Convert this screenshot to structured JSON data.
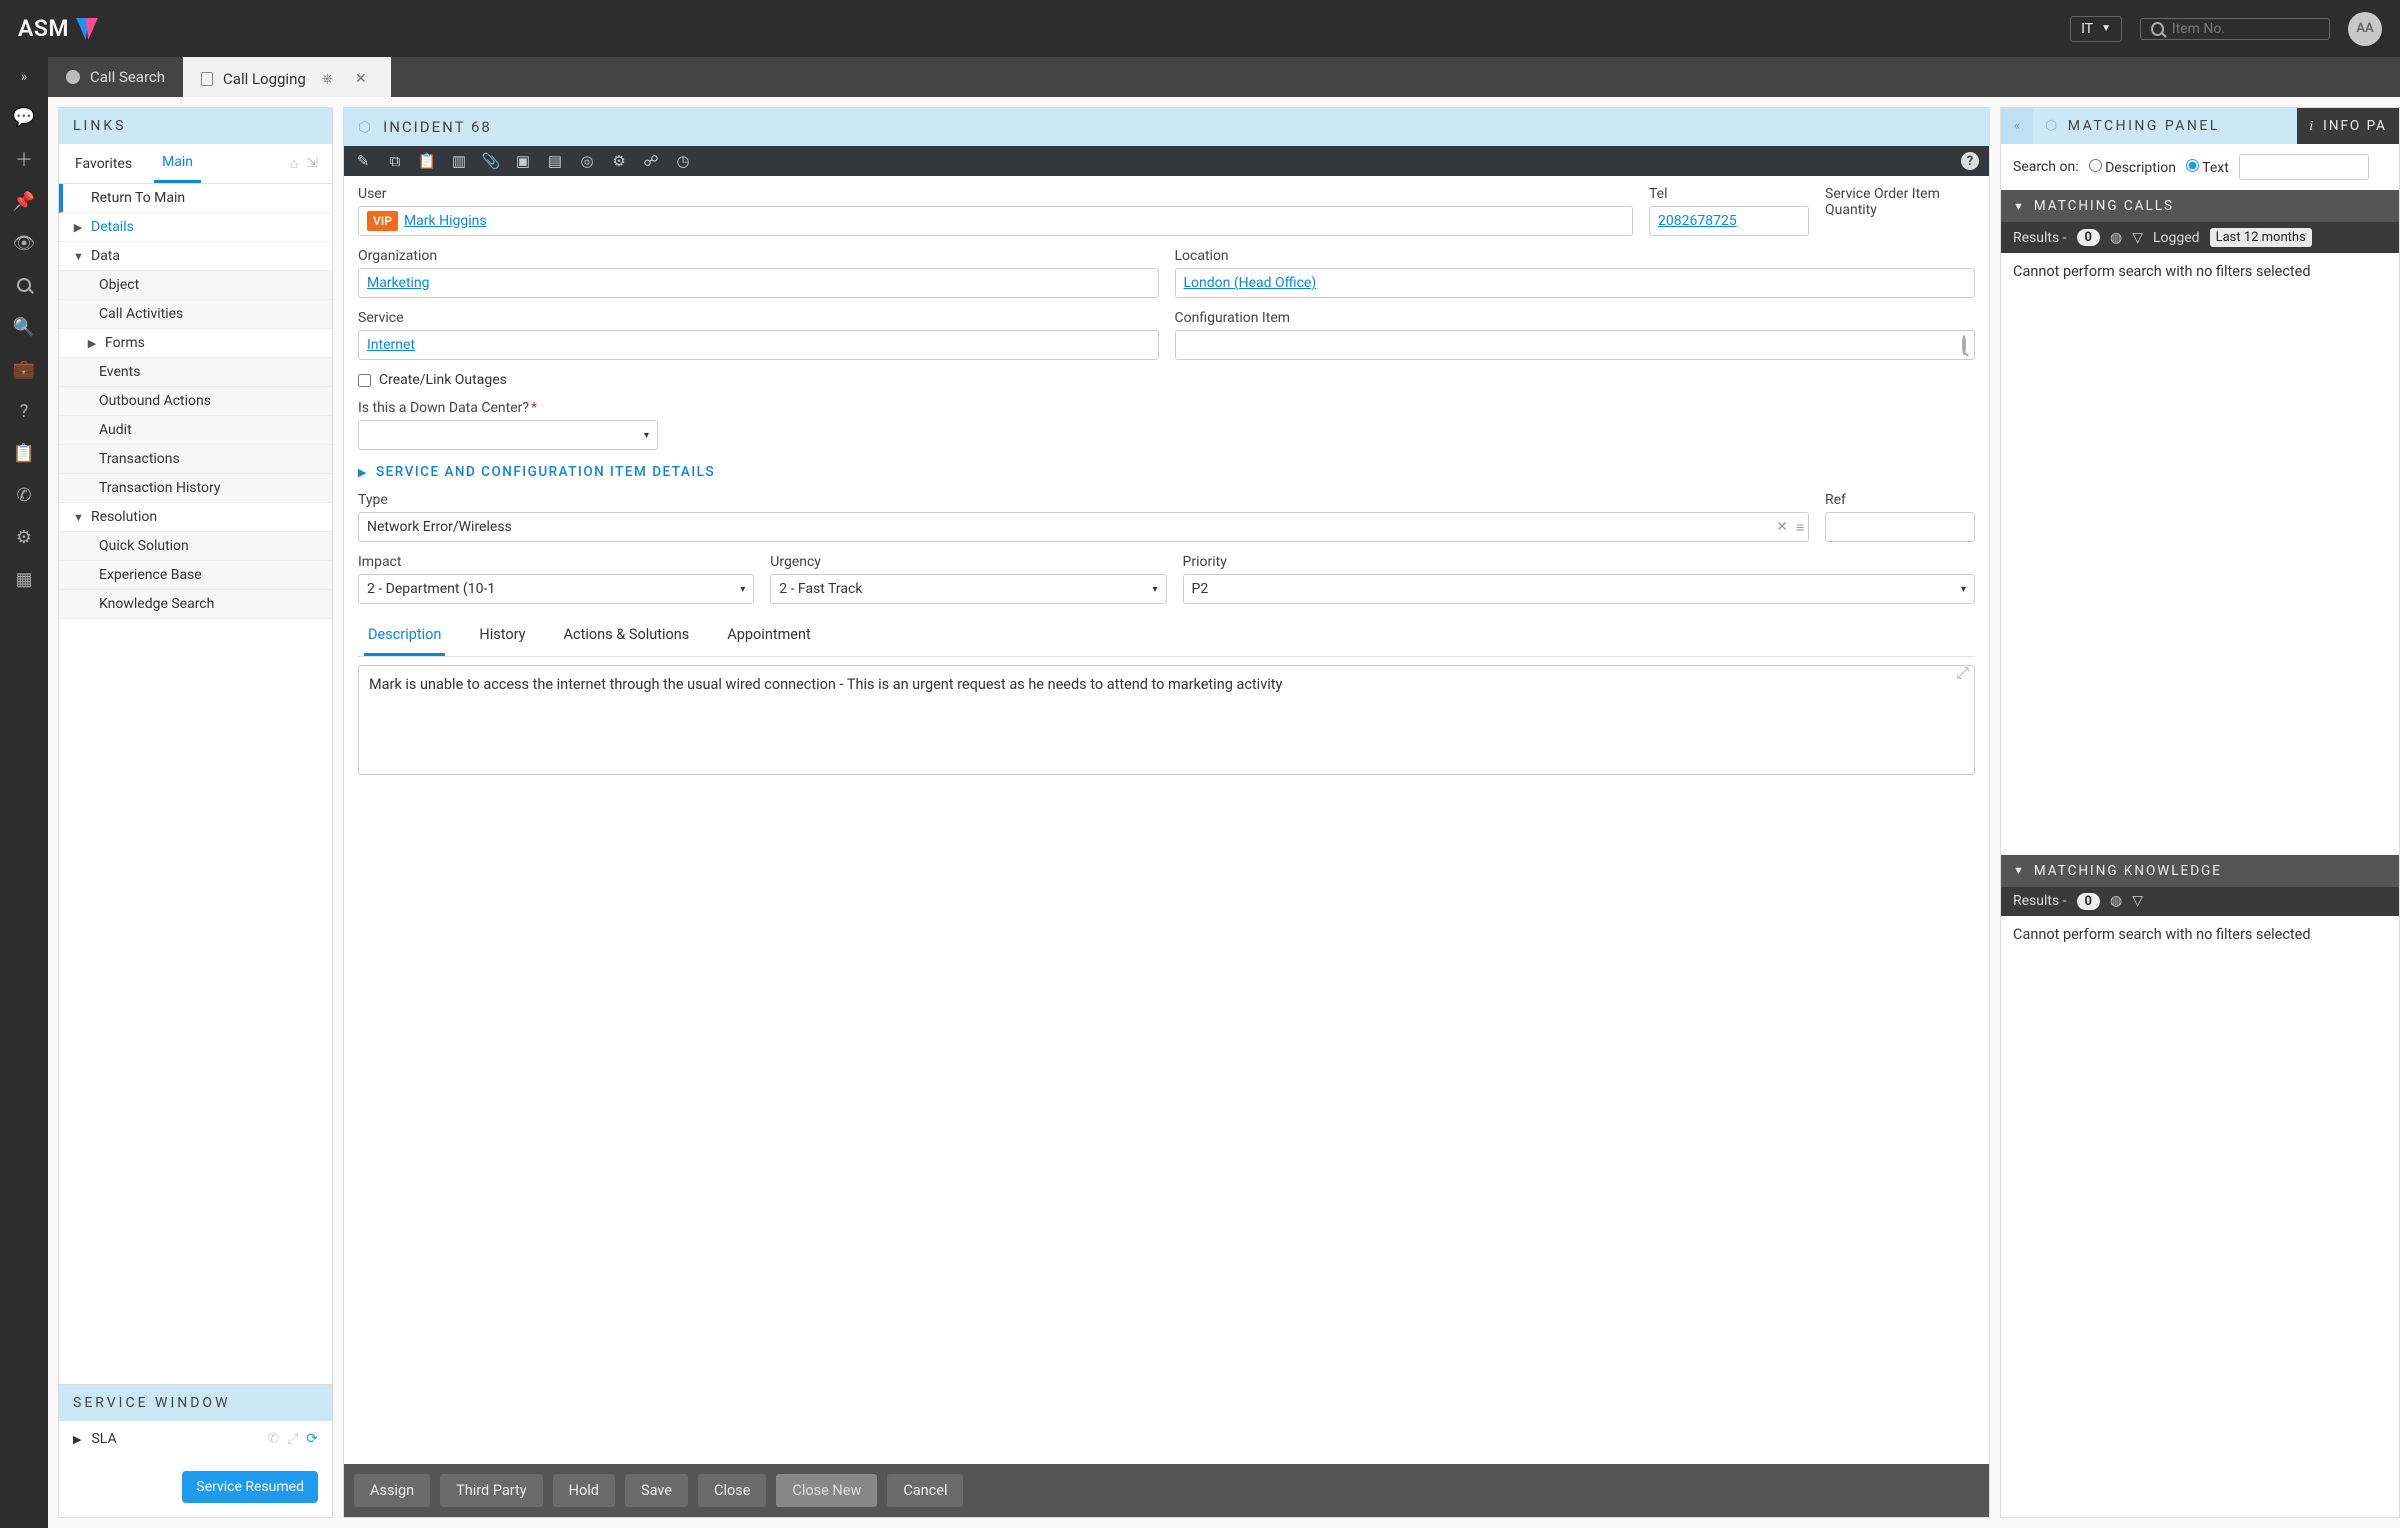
{
  "topbar": {
    "logo_text": "ASM",
    "dept_selector": "IT",
    "item_search_placeholder": "Item No.",
    "avatar_initials": "AA"
  },
  "tabs": {
    "call_search": "Call Search",
    "call_logging": "Call Logging"
  },
  "links": {
    "title": "LINKS",
    "tab_favorites": "Favorites",
    "tab_main": "Main",
    "items": {
      "return_to_main": "Return To Main",
      "details": "Details",
      "data": "Data",
      "object": "Object",
      "call_activities": "Call Activities",
      "forms": "Forms",
      "events": "Events",
      "outbound_actions": "Outbound Actions",
      "audit": "Audit",
      "transactions": "Transactions",
      "transaction_history": "Transaction History",
      "resolution": "Resolution",
      "quick_solution": "Quick Solution",
      "experience_base": "Experience Base",
      "knowledge_search": "Knowledge Search"
    },
    "service_window_title": "SERVICE WINDOW",
    "sla": "SLA",
    "service_resumed_btn": "Service Resumed"
  },
  "incident": {
    "title": "INCIDENT 68",
    "labels": {
      "user": "User",
      "tel": "Tel",
      "soiq": "Service Order Item Quantity",
      "organization": "Organization",
      "location": "Location",
      "service": "Service",
      "config_item": "Configuration Item",
      "create_outages": "Create/Link Outages",
      "down_dc": "Is this a Down Data Center?",
      "section_sci": "SERVICE AND CONFIGURATION ITEM DETAILS",
      "type": "Type",
      "ref": "Ref",
      "impact": "Impact",
      "urgency": "Urgency",
      "priority": "Priority"
    },
    "values": {
      "vip": "VIP",
      "user_name": "Mark Higgins",
      "tel": "2082678725",
      "organization": "Marketing",
      "location": "London (Head Office)",
      "service": "Internet",
      "type": "Network Error/Wireless",
      "impact": "2 - Department (10-1",
      "urgency": "2 - Fast Track",
      "priority": "P2",
      "description": "Mark is unable to access the internet through the usual wired connection - This is an urgent request as he needs to attend to marketing activity"
    },
    "subtabs": {
      "description": "Description",
      "history": "History",
      "actions": "Actions & Solutions",
      "appointment": "Appointment"
    },
    "actions": {
      "assign": "Assign",
      "third_party": "Third Party",
      "hold": "Hold",
      "save": "Save",
      "close": "Close",
      "close_new": "Close New",
      "cancel": "Cancel"
    }
  },
  "matching": {
    "title": "MATCHING PANEL",
    "info_pane": "INFO PA",
    "search_on_label": "Search on:",
    "opt_description": "Description",
    "opt_text": "Text",
    "calls_header": "MATCHING CALLS",
    "results_label": "Results -",
    "calls_count": "0",
    "logged_label": "Logged",
    "logged_value": "Last 12 months",
    "no_filters": "Cannot perform search with no filters selected",
    "knowledge_header": "MATCHING KNOWLEDGE",
    "knowledge_count": "0"
  }
}
